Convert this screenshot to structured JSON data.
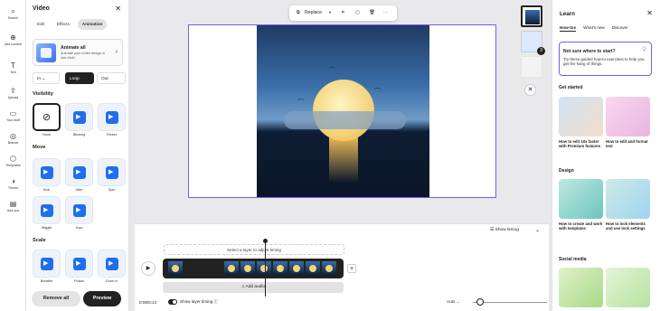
{
  "rail": [
    {
      "label": "Search",
      "icon": "⌕"
    },
    {
      "label": "Add content",
      "icon": "⊕"
    },
    {
      "label": "Text",
      "icon": "T"
    },
    {
      "label": "Upload",
      "icon": "⇪"
    },
    {
      "label": "Your stuff",
      "icon": "▭"
    },
    {
      "label": "Brands",
      "icon": "◎"
    },
    {
      "label": "Templates",
      "icon": "⬡"
    },
    {
      "label": "Theme",
      "icon": "◑"
    },
    {
      "label": "Add-ons",
      "icon": "▤"
    }
  ],
  "panel": {
    "title": "Video",
    "tabs": [
      "Edit",
      "Effects",
      "Animation"
    ],
    "animate_all": {
      "title": "Animate all",
      "subtitle": "Animate your entire design in one click!"
    },
    "direction": [
      "In",
      "Loop",
      "Out"
    ],
    "visibility": {
      "title": "Visibility",
      "items": [
        "None",
        "Blinking",
        "Flicker"
      ]
    },
    "move": {
      "title": "Move",
      "items": [
        "Bob",
        "Jitter",
        "Spin",
        "Wiggle",
        "Yoyo"
      ]
    },
    "scale": {
      "title": "Scale",
      "items": [
        "Breathe",
        "Pulsar",
        "Zoom in"
      ]
    },
    "remove_all": "Remove all",
    "preview": "Preview"
  },
  "toolbar": {
    "replace": "Replace"
  },
  "timeline": {
    "show_timing": "Show timing",
    "hint": "Select a layer to adjust timing",
    "add_audio": "Add audio",
    "time": "0:08/0:14",
    "show_layer_timing": "Show layer timing",
    "auto": "Auto"
  },
  "learn": {
    "title": "Learn",
    "tabs": [
      "How-tos",
      "What's new",
      "Discover"
    ],
    "tip": {
      "title": "Not sure where to start?",
      "text": "Try these guided how-to exercises to help you get the hang of things."
    },
    "get_started": "Get started",
    "cards1": [
      "How to edit 10x faster with Premium features",
      "How to edit and format text"
    ],
    "design": "Design",
    "cards2": [
      "How to create and work with templates",
      "How to lock elements and use lock settings"
    ],
    "social": "Social media"
  },
  "colors": {
    "accent": "#7a5cf0",
    "dark": "#222222",
    "blue": "#1f6feb"
  }
}
